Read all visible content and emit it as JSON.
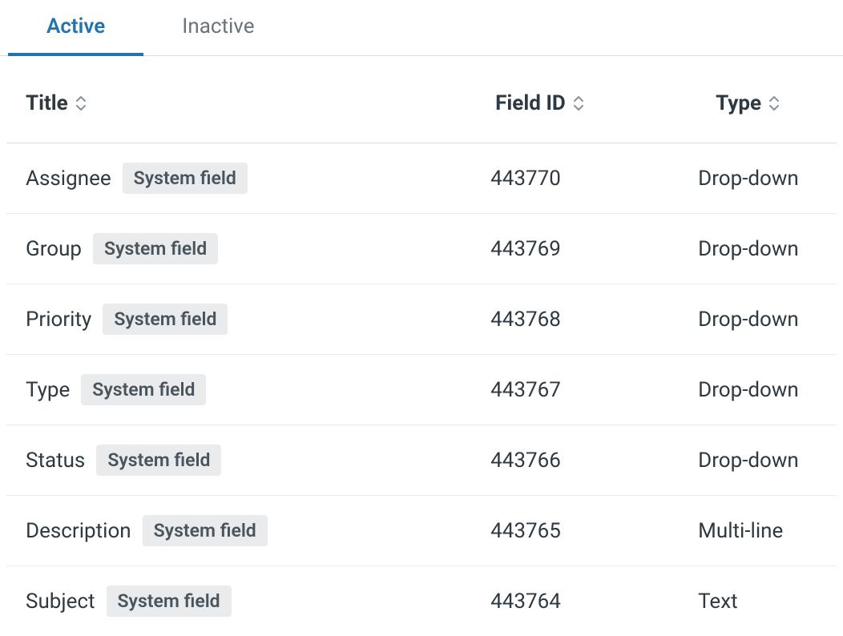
{
  "tabs": {
    "active": "Active",
    "inactive": "Inactive"
  },
  "columns": {
    "title": "Title",
    "field_id": "Field ID",
    "type": "Type"
  },
  "badge_label": "System field",
  "rows": [
    {
      "title": "Assignee",
      "field_id": "443770",
      "type": "Drop-down"
    },
    {
      "title": "Group",
      "field_id": "443769",
      "type": "Drop-down"
    },
    {
      "title": "Priority",
      "field_id": "443768",
      "type": "Drop-down"
    },
    {
      "title": "Type",
      "field_id": "443767",
      "type": "Drop-down"
    },
    {
      "title": "Status",
      "field_id": "443766",
      "type": "Drop-down"
    },
    {
      "title": "Description",
      "field_id": "443765",
      "type": "Multi-line"
    },
    {
      "title": "Subject",
      "field_id": "443764",
      "type": "Text"
    }
  ]
}
